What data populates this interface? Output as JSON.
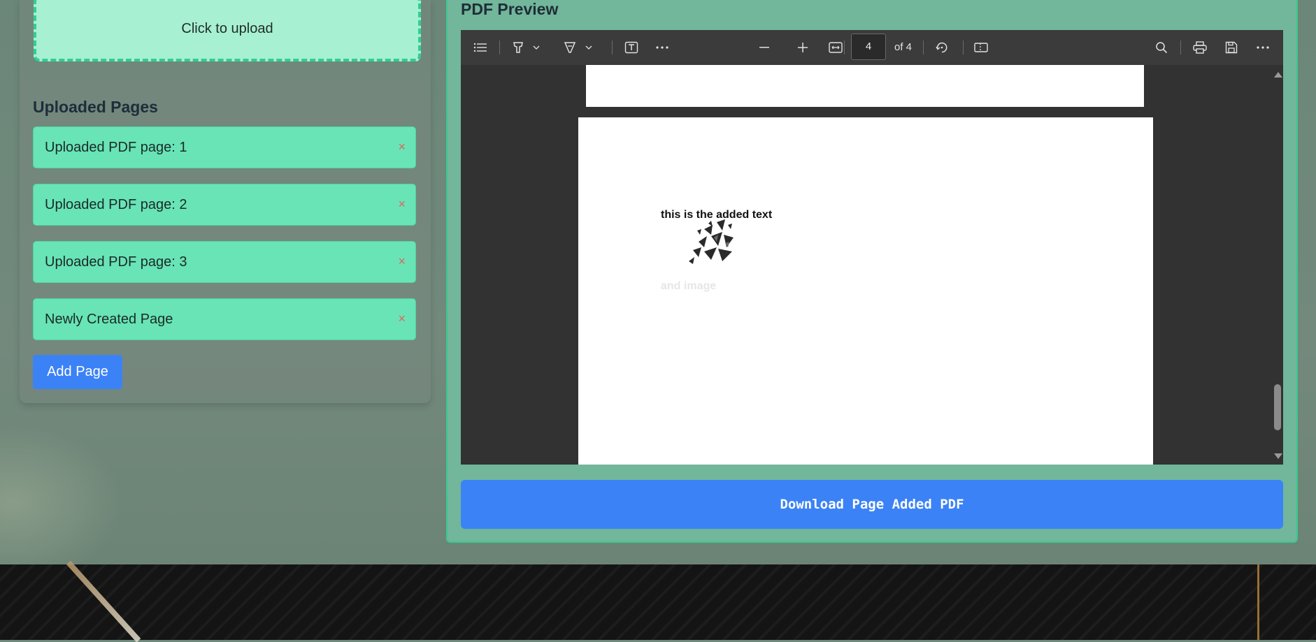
{
  "upload": {
    "label": "Click to upload"
  },
  "uploaded_pages": {
    "title": "Uploaded Pages",
    "items": [
      {
        "label": "Uploaded PDF page: 1",
        "remove": "×"
      },
      {
        "label": "Uploaded PDF page: 2",
        "remove": "×"
      },
      {
        "label": "Uploaded PDF page: 3",
        "remove": "×"
      },
      {
        "label": "Newly Created Page",
        "remove": "×"
      }
    ],
    "add_button": "Add Page"
  },
  "preview": {
    "title": "PDF Preview",
    "toolbar": {
      "icons": [
        "contents-icon",
        "highlight-icon",
        "draw-icon",
        "text-box-icon",
        "more-tools-icon",
        "zoom-out-icon",
        "zoom-in-icon",
        "fit-width-icon",
        "rotate-icon",
        "page-view-icon",
        "search-icon",
        "print-icon",
        "save-icon",
        "more-options-icon"
      ],
      "page_number": "4",
      "page_of": "of 4"
    },
    "document": {
      "added_text": "this is the added text",
      "image_caption": "and image"
    }
  },
  "download": {
    "label": "Download Page Added PDF"
  },
  "colors": {
    "accent_blue": "#3b82f6",
    "item_green": "#68e4b7",
    "upload_green": "#a8f0d2",
    "remove_red": "#e0665d"
  }
}
